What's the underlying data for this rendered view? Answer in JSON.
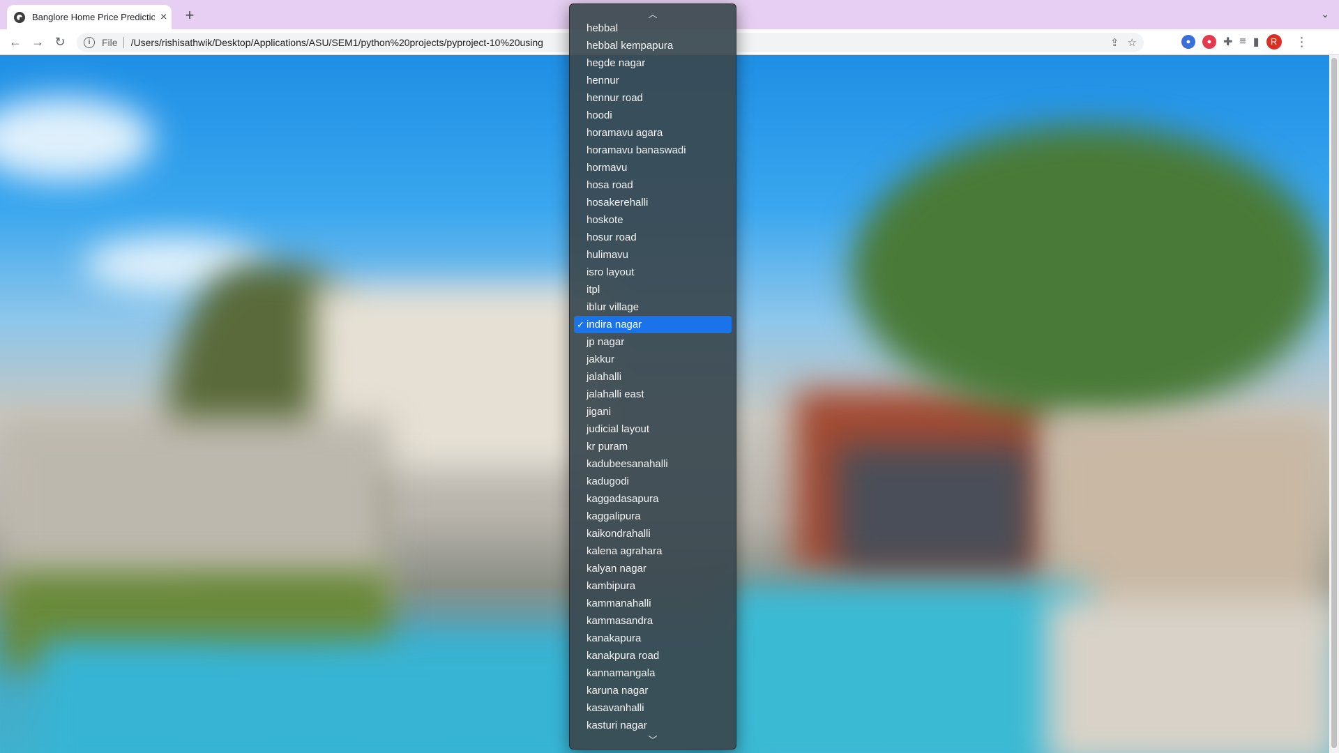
{
  "browser": {
    "tab_title": "Banglore Home Price Predictio",
    "new_tab_symbol": "+",
    "close_symbol": "×",
    "scheme": "File",
    "url": "/Users/rishisathwik/Desktop/Applications/ASU/SEM1/python%20projects/pyproject-10%20using",
    "avatar_letter": "R"
  },
  "dropdown": {
    "selected": "indira nagar",
    "options": [
      "hebbal",
      "hebbal kempapura",
      "hegde nagar",
      "hennur",
      "hennur road",
      "hoodi",
      "horamavu agara",
      "horamavu banaswadi",
      "hormavu",
      "hosa road",
      "hosakerehalli",
      "hoskote",
      "hosur road",
      "hulimavu",
      "isro layout",
      "itpl",
      "iblur village",
      "indira nagar",
      "jp nagar",
      "jakkur",
      "jalahalli",
      "jalahalli east",
      "jigani",
      "judicial layout",
      "kr puram",
      "kadubeesanahalli",
      "kadugodi",
      "kaggadasapura",
      "kaggalipura",
      "kaikondrahalli",
      "kalena agrahara",
      "kalyan nagar",
      "kambipura",
      "kammanahalli",
      "kammasandra",
      "kanakapura",
      "kanakpura road",
      "kannamangala",
      "karuna nagar",
      "kasavanhalli",
      "kasturi nagar"
    ]
  },
  "colors": {
    "tabstrip": "#e6cff2",
    "selection": "#1a73e8",
    "popup_bg": "#3a4850"
  }
}
